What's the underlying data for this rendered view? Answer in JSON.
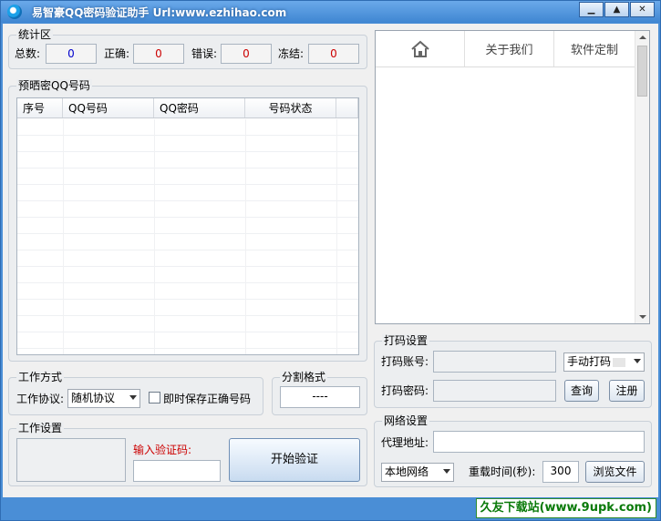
{
  "window": {
    "title": "易智豪QQ密码验证助手 Url:www.ezhihao.com",
    "buttons": {
      "minimize": "▁",
      "maximize": "▲",
      "close": "✕"
    }
  },
  "stats": {
    "title": "统计区",
    "total_label": "总数:",
    "total_value": "0",
    "correct_label": "正确:",
    "correct_value": "0",
    "error_label": "错误:",
    "error_value": "0",
    "frozen_label": "冻结:",
    "frozen_value": "0"
  },
  "qq_list": {
    "title": "预晒密QQ号码",
    "columns": [
      "序号",
      "QQ号码",
      "QQ密码",
      "号码状态"
    ],
    "rows": []
  },
  "work_mode": {
    "title": "工作方式",
    "protocol_label": "工作协议:",
    "protocol_value": "随机协议",
    "save_checkbox_label": "即时保存正确号码",
    "save_checked": false
  },
  "split_format": {
    "title": "分割格式",
    "value": "----"
  },
  "work_settings": {
    "title": "工作设置",
    "captcha_label": "输入验证码:",
    "captcha_value": "",
    "start_button": "开始验证"
  },
  "browser": {
    "nav": [
      "home-icon",
      "关于我们",
      "软件定制"
    ]
  },
  "captcha_settings": {
    "title": "打码设置",
    "account_label": "打码账号:",
    "account_value": "",
    "mode_value": "手动打码",
    "password_label": "打码密码:",
    "password_value": "",
    "query_button": "查询",
    "register_button": "注册"
  },
  "network_settings": {
    "title": "网络设置",
    "proxy_label": "代理地址:",
    "proxy_value": "",
    "network_value": "本地网络",
    "reload_label": "重载时间(秒):",
    "reload_value": "300",
    "browse_button": "浏览文件"
  },
  "watermark": "久友下载站(www.9upk.com)",
  "colors": {
    "title_bar": "#3f86d2",
    "window_bg": "#f0f0f0",
    "stat_blue": "#0000cc",
    "stat_red": "#cc0000",
    "captcha_label": "#cc0000",
    "watermark_green": "#0a7a0a"
  }
}
